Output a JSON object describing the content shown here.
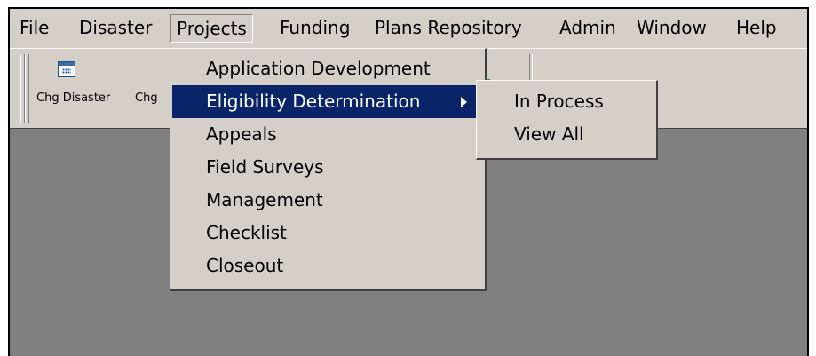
{
  "menubar": {
    "items": [
      "File",
      "Disaster",
      "Projects",
      "Funding",
      "Plans Repository",
      "Admin",
      "Window",
      "Help"
    ]
  },
  "toolbar": {
    "buttons": [
      {
        "label": "Chg Disaster",
        "icon": "calendar-icon"
      },
      {
        "label": "Chg",
        "icon": "partial-icon"
      }
    ]
  },
  "projects_menu": {
    "items": [
      "Application Development",
      "Eligibility Determination",
      "Appeals",
      "Field Surveys",
      "Management",
      "Checklist",
      "Closeout"
    ],
    "highlighted": "Eligibility Determination"
  },
  "submenu": {
    "items": [
      "In Process",
      "View All"
    ]
  },
  "colors": {
    "menu_face": "#d4d0c8",
    "highlight": "#0a246a",
    "mdi_background": "#808080"
  }
}
